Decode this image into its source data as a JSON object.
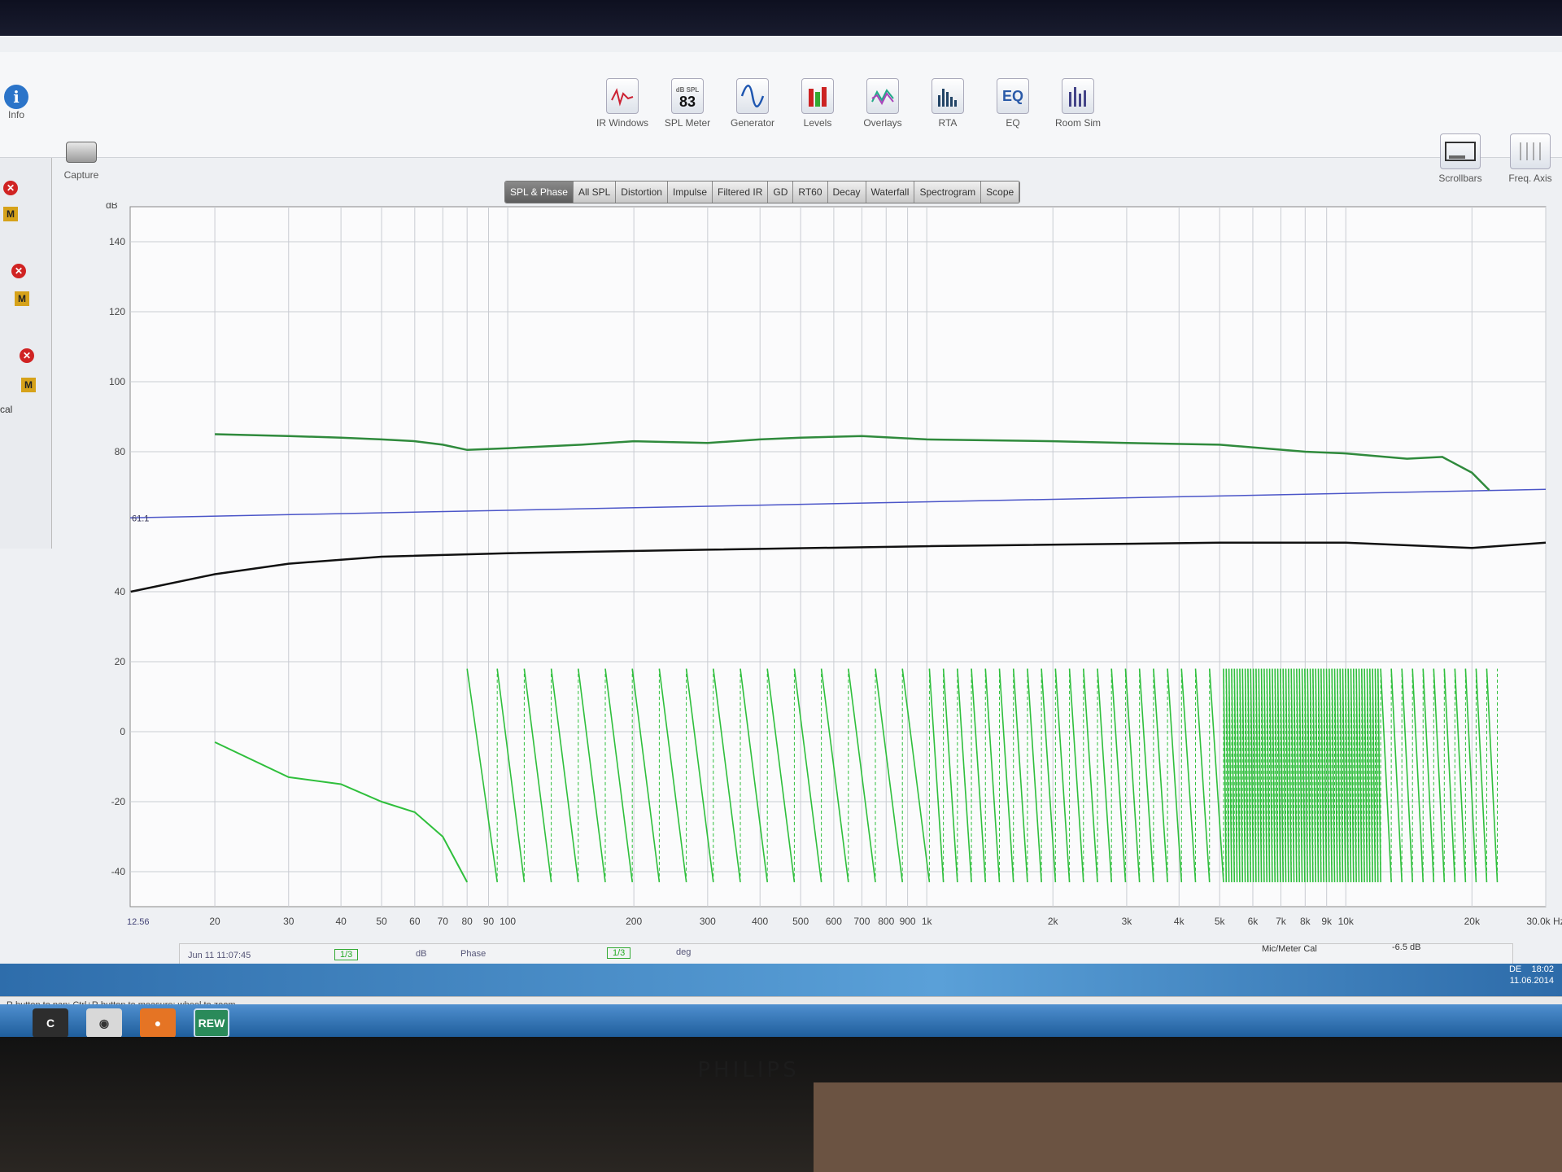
{
  "toolbar": {
    "info_label": "Info",
    "tools": [
      {
        "label": "IR Windows",
        "icon": "ir-windows-icon"
      },
      {
        "label": "SPL Meter",
        "icon": "spl-meter-icon",
        "value": "83",
        "sub": "dB SPL"
      },
      {
        "label": "Generator",
        "icon": "generator-icon"
      },
      {
        "label": "Levels",
        "icon": "levels-icon"
      },
      {
        "label": "Overlays",
        "icon": "overlays-icon"
      },
      {
        "label": "RTA",
        "icon": "rta-icon"
      },
      {
        "label": "EQ",
        "icon": "eq-icon",
        "value": "EQ"
      },
      {
        "label": "Room Sim",
        "icon": "room-sim-icon"
      }
    ],
    "right_tools": [
      {
        "label": "Scrollbars"
      },
      {
        "label": "Freq. Axis"
      }
    ],
    "capture_label": "Capture"
  },
  "tabs": [
    "SPL & Phase",
    "All SPL",
    "Distortion",
    "Impulse",
    "Filtered IR",
    "GD",
    "RT60",
    "Decay",
    "Waterfall",
    "Spectrogram",
    "Scope"
  ],
  "active_tab": "SPL & Phase",
  "left_panel": {
    "cal_label": "cal"
  },
  "chart_data": {
    "type": "line",
    "ylabel": "dB",
    "x_scale": "log",
    "xlim": [
      12.56,
      30000
    ],
    "ylim": [
      -50,
      150
    ],
    "y_ticks": [
      140,
      120,
      100,
      80,
      40,
      20,
      0,
      -20,
      -40
    ],
    "x_tick_labels": [
      "20",
      "30",
      "40",
      "50",
      "60",
      "70",
      "80",
      "90",
      "100",
      "200",
      "300",
      "400",
      "500",
      "600",
      "700",
      "800",
      "900",
      "1k",
      "2k",
      "3k",
      "4k",
      "5k",
      "6k",
      "7k",
      "8k",
      "9k",
      "10k",
      "20k",
      "30.0k Hz"
    ],
    "x_min_label": "12.56",
    "cursor_label": "61.1",
    "cursor_value": 61.1,
    "series": [
      {
        "color": "#2f8a3c",
        "x": [
          20,
          30,
          40,
          50,
          60,
          70,
          80,
          100,
          150,
          200,
          300,
          400,
          500,
          700,
          1000,
          2000,
          3000,
          5000,
          8000,
          10000,
          14000,
          17000,
          20000,
          22000
        ],
        "y": [
          85,
          84.5,
          84,
          83.5,
          83,
          82,
          80.5,
          81,
          82,
          83,
          82.5,
          83.5,
          84,
          84.5,
          83.5,
          83,
          82.5,
          82,
          80,
          79.5,
          78,
          78.5,
          74,
          69
        ]
      },
      {
        "color": "#111111",
        "x": [
          12.6,
          20,
          30,
          50,
          100,
          300,
          1000,
          5000,
          10000,
          20000,
          30000
        ],
        "y": [
          40,
          45,
          48,
          50,
          51,
          52,
          53,
          54,
          54,
          52.5,
          54
        ]
      },
      {
        "name": "Phase",
        "color": "#2fbf3c",
        "x": [
          20,
          30,
          40,
          50,
          60,
          70,
          80
        ],
        "y": [
          -3,
          -13,
          -15,
          -20,
          -23,
          -30,
          -43
        ]
      }
    ]
  },
  "legend": {
    "measurement": "Jun 11 11:07:45",
    "smoothing": "1/3",
    "unit_db": "dB",
    "phase_label": "Phase",
    "smoothing2": "1/3",
    "unit_deg": "deg",
    "mic_cal": "Mic/Meter Cal",
    "mic_cal_value": "-6.5 dB"
  },
  "status_text": "R button to pan; Ctrl+R button to measure; wheel to zoom",
  "tray": {
    "lang": "DE",
    "time": "18:02",
    "date": "11.06.2014"
  },
  "taskbar_app": "REW",
  "monitor_brand": "PHILIPS"
}
